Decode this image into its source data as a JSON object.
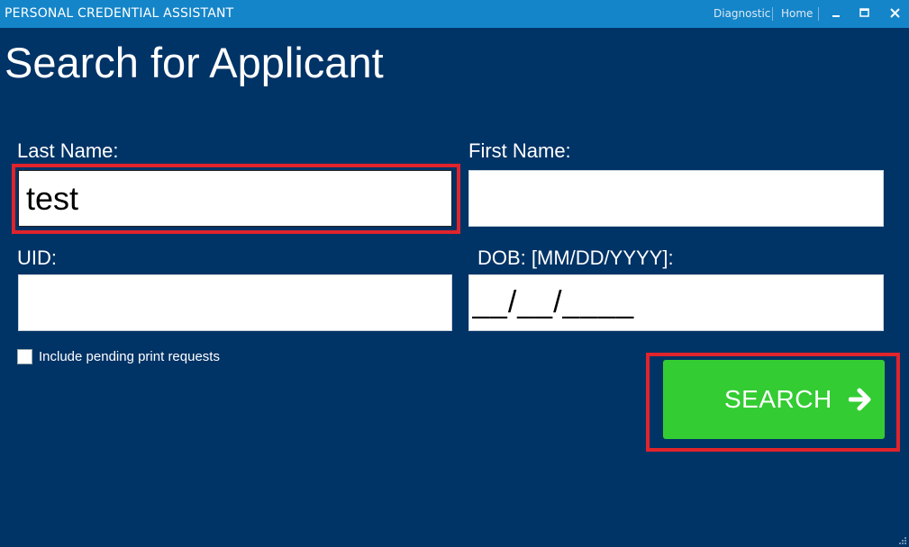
{
  "window": {
    "title": "PERSONAL CREDENTIAL ASSISTANT",
    "links": {
      "diagnostic": "Diagnostic",
      "home": "Home"
    },
    "controls": {
      "minimize": "minimize-icon",
      "maximize": "maximize-icon",
      "close": "close-icon"
    }
  },
  "page": {
    "title": "Search for Applicant"
  },
  "form": {
    "last_name": {
      "label": "Last Name:",
      "value": "test"
    },
    "first_name": {
      "label": "First Name:",
      "value": ""
    },
    "uid": {
      "label": "UID:",
      "value": ""
    },
    "dob": {
      "label": "DOB: [MM/DD/YYYY]:",
      "value": "__/__/____"
    },
    "include_pending": {
      "label": "Include pending print requests",
      "checked": false
    }
  },
  "search_button": {
    "label": "SEARCH",
    "icon": "arrow-right-icon"
  },
  "colors": {
    "background": "#003366",
    "titlebar": "#1585c9",
    "search_button": "#33cc33",
    "highlight": "#e0242c"
  }
}
